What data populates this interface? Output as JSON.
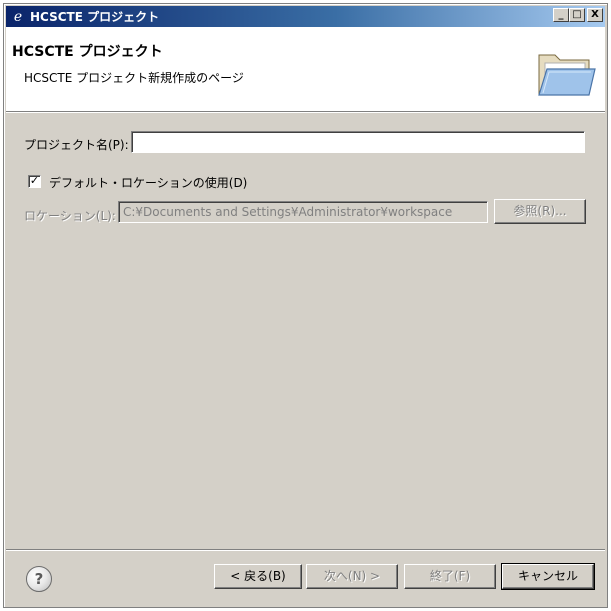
{
  "window": {
    "title": "HCSCTE プロジェクト",
    "buttons": {
      "minimize": "_",
      "maximize": "□",
      "close": "X"
    }
  },
  "banner": {
    "title": "HCSCTE プロジェクト",
    "subtitle": "HCSCTE プロジェクト新規作成のページ",
    "icon": "open-folder-icon"
  },
  "form": {
    "project_name_label": "プロジェクト名(P):",
    "project_name_value": "",
    "default_location_checked": true,
    "default_location_label": "デフォルト・ロケーションの使用(D)",
    "location_label": "ロケーション(L):",
    "location_value": "C:¥Documents and Settings¥Administrator¥workspace",
    "browse_label": "参照(R)..."
  },
  "footer": {
    "help_icon": "help-icon",
    "back_label": "< 戻る(B)",
    "next_label": "次へ(N) >",
    "finish_label": "終了(F)",
    "cancel_label": "キャンセル"
  }
}
